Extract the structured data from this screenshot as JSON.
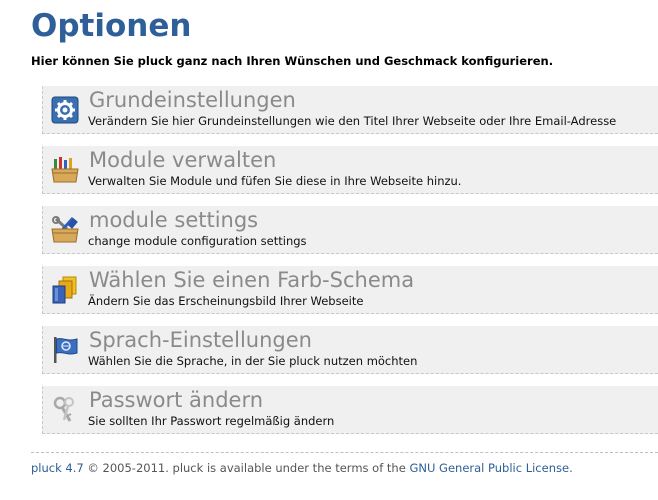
{
  "page": {
    "title": "Optionen",
    "subtitle": "Hier können Sie pluck ganz nach Ihren Wünschen und Geschmack konfigurieren."
  },
  "options": [
    {
      "title": "Grundeinstellungen",
      "description": "Verändern Sie hier Grundeinstellungen wie den Titel Ihrer Webseite oder Ihre Email-Adresse",
      "icon": "gear-icon"
    },
    {
      "title": "Module verwalten",
      "description": "Verwalten Sie Module und füfen Sie diese in Ihre Webseite hinzu.",
      "icon": "module-box-icon"
    },
    {
      "title": "module settings",
      "description": "change module configuration settings",
      "icon": "module-tools-icon"
    },
    {
      "title": "Wählen Sie einen Farb-Schema",
      "description": "Ändern Sie das Erscheinungsbild Ihrer Webseite",
      "icon": "color-scheme-icon"
    },
    {
      "title": "Sprach-Einstellungen",
      "description": "Wählen Sie die Sprache, in der Sie pluck nutzen möchten",
      "icon": "language-flag-icon"
    },
    {
      "title": "Passwort ändern",
      "description": "Sie sollten Ihr Passwort regelmäßig ändern",
      "icon": "keys-icon"
    }
  ],
  "footer": {
    "version_link": "pluck 4.7",
    "copyright": " © 2005-2011. pluck is available under the terms of the ",
    "license_link": "GNU General Public License",
    "end": "."
  },
  "colors": {
    "title": "#2e5f98",
    "option_bg": "#f0f0f0",
    "option_title": "#8a8a8a",
    "link": "#2e5f98"
  }
}
